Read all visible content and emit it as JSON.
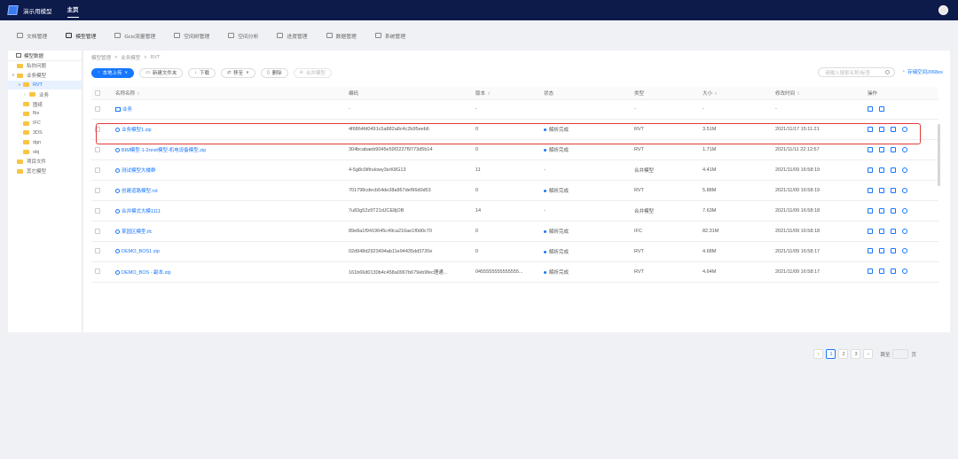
{
  "header": {
    "brand": "演示用模型",
    "nav_home": "主页"
  },
  "module_tabs": [
    {
      "label": "文档管理",
      "icon": "document-icon"
    },
    {
      "label": "模型管理",
      "icon": "model-icon",
      "active": true
    },
    {
      "label": "Gcis流量管理",
      "icon": "flow-icon"
    },
    {
      "label": "空间树管理",
      "icon": "space-tree-icon"
    },
    {
      "label": "空间分析",
      "icon": "analysis-icon"
    },
    {
      "label": "进度管理",
      "icon": "progress-icon"
    },
    {
      "label": "数据管理",
      "icon": "data-icon"
    },
    {
      "label": "系统管理",
      "icon": "system-icon"
    }
  ],
  "sidebar": {
    "title": "模型数据",
    "items": [
      {
        "label": "私你问题",
        "depth": 1,
        "arrow": ""
      },
      {
        "label": "业务模型",
        "depth": 1,
        "arrow": "∨"
      },
      {
        "label": "RVT",
        "depth": 2,
        "arrow": "∨",
        "selected": true
      },
      {
        "label": "业务",
        "depth": 3,
        "arrow": "›"
      },
      {
        "label": "图纸",
        "depth": 2,
        "arrow": ""
      },
      {
        "label": "fbx",
        "depth": 2,
        "arrow": ""
      },
      {
        "label": "IFC",
        "depth": 2,
        "arrow": ""
      },
      {
        "label": "3DS",
        "depth": 2,
        "arrow": ""
      },
      {
        "label": "dgn",
        "depth": 2,
        "arrow": ""
      },
      {
        "label": "obj",
        "depth": 2,
        "arrow": ""
      },
      {
        "label": "项目文件",
        "depth": 1,
        "arrow": ""
      },
      {
        "label": "其它模型",
        "depth": 1,
        "arrow": ""
      }
    ]
  },
  "breadcrumb": [
    "模型管理",
    ">",
    "业务模型",
    ">",
    "RVT"
  ],
  "toolbar": {
    "upload": "本地上传",
    "new_folder": "新建文件夹",
    "download": "下载",
    "move": "移至",
    "delete": "删除",
    "merge": "合并模型",
    "search_placeholder": "请输入搜索名称/标签",
    "storage": "存储空间2068es"
  },
  "table": {
    "headers": [
      "名称名称",
      "编码",
      "版本",
      "状态",
      "类型",
      "大小",
      "修改时间",
      "操作"
    ],
    "rows": [
      {
        "name": "业务",
        "code": "-",
        "version": "-",
        "status": "",
        "type": "-",
        "size": "-",
        "time": "-",
        "folder": true
      },
      {
        "name": "业务模型1.zip",
        "code": "4f6864fd0491c5a882a8c4c2b95eeb6",
        "version": "0",
        "status": "解析完成",
        "type": "RVT",
        "size": "3.51M",
        "time": "2021/11/17 15:11:21"
      },
      {
        "name": "BIM模型-1-2revit模型-机电设备模型.zip",
        "code": "304bcabaeb9045e59f2227f9773d5b14",
        "version": "0",
        "status": "解析完成",
        "type": "RVT",
        "size": "1.71M",
        "time": "2021/11/11 22:12:57"
      },
      {
        "name": "测试模型大楼群",
        "code": "4-5g8c0iflrulowy3srK8G13",
        "version": "11",
        "status": "-",
        "type": "合并模型",
        "size": "4.41M",
        "time": "2021/11/09 16:58:19"
      },
      {
        "name": "创建道路模型.rvt",
        "code": "701798cdecb54de38a867def96d0d53",
        "version": "0",
        "status": "解析完成",
        "type": "RVT",
        "size": "5.88M",
        "time": "2021/11/09 16:58:19"
      },
      {
        "name": "合并模式大模1111",
        "code": "7u83g52z9T21dJCE8jOB",
        "version": "14",
        "status": "-",
        "type": "合并模型",
        "size": "7.63M",
        "time": "2021/11/09 16:58:18"
      },
      {
        "name": "某园区模型.ifc",
        "code": "89e8a1f9419645c49ca216ae1f0d0c70",
        "version": "0",
        "status": "解析完成",
        "type": "IFC",
        "size": "82.31M",
        "time": "2021/11/09 16:58:18"
      },
      {
        "name": "DEMO_BOS1.zip",
        "code": "02d948d2923494ab11e94435dd3720e",
        "version": "0",
        "status": "解析完成",
        "type": "RVT",
        "size": "4.68M",
        "time": "2021/11/09 16:58:17"
      },
      {
        "name": "DEMO_BOS - 副本.zip",
        "code": "161b66d0130b4c458a0967b679eb9fec理通...",
        "version": "0455555555555555...",
        "status": "解析完成",
        "type": "RVT",
        "size": "4.64M",
        "time": "2021/11/09 16:58:17"
      }
    ]
  },
  "pagination": {
    "prev": "‹",
    "pages": [
      "1",
      "2",
      "3"
    ],
    "next": "›",
    "goto_label": "跳至",
    "page_unit": "页"
  },
  "colors": {
    "topbar": "#0d1b4b",
    "accent": "#1677ff",
    "highlight": "#e03a3a"
  }
}
